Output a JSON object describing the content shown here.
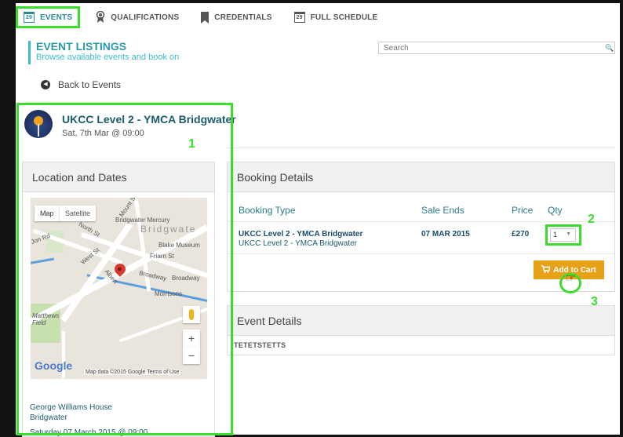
{
  "nav": {
    "events": "EVENTS",
    "qualifications": "QUALIFICATIONS",
    "credentials": "CREDENTIALS",
    "full_schedule": "FULL SCHEDULE",
    "calendar_day": "29"
  },
  "header": {
    "title": "EVENT LISTINGS",
    "subtitle": "Browse available events and book on",
    "search_placeholder": "Search"
  },
  "back_label": "Back to Events",
  "event": {
    "title": "UKCC Level 2 - YMCA Bridgwater",
    "date": "Sat, 7th Mar @ 09:00"
  },
  "location": {
    "heading": "Location and Dates",
    "map_tab_map": "Map",
    "map_tab_satellite": "Satellite",
    "map_labels": {
      "bridgwater_mercury": "Bridgwater Mercury",
      "bridgwater": "Bridgwate",
      "blake_museum": "Blake Museum",
      "friarn_st": "Friarn St",
      "broadway": "Broadway",
      "broadway2": "Broadway",
      "morrisons": "Morrisons",
      "matthews_field": "Matthews Field",
      "north_st": "North St",
      "west_st": "West St",
      "mount_st": "Mount St",
      "jon_rd": "Jon Rd",
      "albert": "Albert"
    },
    "google": "Google",
    "map_footer": "Map data ©2015 Google   Terms of Use",
    "venue": "George Williams House",
    "town": "Bridgwater",
    "session": "Saturday 07 March 2015 @ 09:00"
  },
  "booking": {
    "heading": "Booking Details",
    "columns": {
      "type": "Booking Type",
      "sale_ends": "Sale Ends",
      "price": "Price",
      "qty": "Qty"
    },
    "row": {
      "title": "UKCC Level 2 - YMCA Bridgwater",
      "subtitle": "UKCC Level 2 - YMCA Bridgwater",
      "sale_ends": "07 MAR 2015",
      "price": "£270",
      "qty": "1"
    },
    "add_to_cart": "Add to Cart"
  },
  "event_details": {
    "heading": "Event Details",
    "body": "TETETSTETTS"
  },
  "annotations": {
    "one": "1",
    "two": "2",
    "three": "3"
  },
  "colors": {
    "annotation": "#3bdc2e",
    "accent": "#2a8b9a",
    "cart_button": "#e8a21a"
  }
}
